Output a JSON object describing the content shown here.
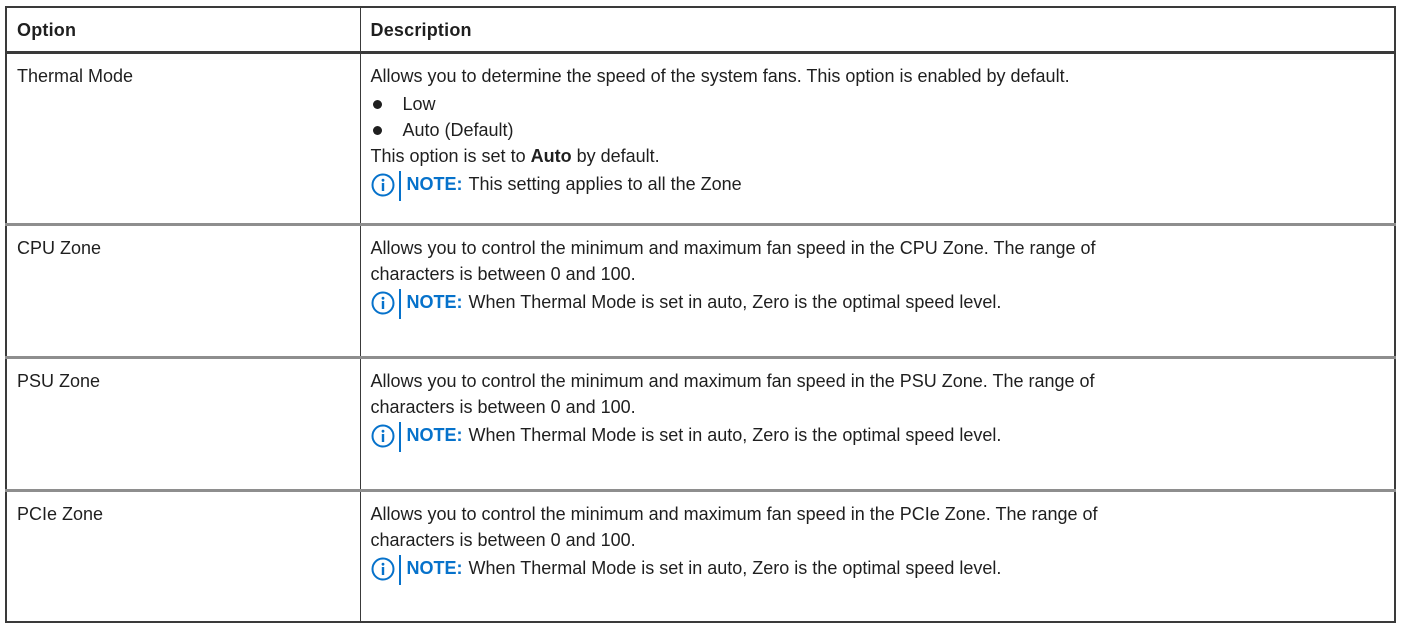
{
  "table": {
    "headers": {
      "option": "Option",
      "description": "Description"
    },
    "rows": [
      {
        "option": "Thermal Mode",
        "description": "Allows you to determine the speed of the system fans. This option is enabled by default.",
        "bullets": [
          "Low",
          "Auto (Default)"
        ],
        "extra_prefix": "This option is set to ",
        "extra_bold": "Auto",
        "extra_suffix": " by default.",
        "note_label": "NOTE:",
        "note_text": "This setting applies to all the Zone"
      },
      {
        "option": "CPU Zone",
        "description_line1": "Allows you to control the minimum and maximum fan speed in the CPU Zone. The range of",
        "description_line2": "characters is between 0 and 100.",
        "note_label": "NOTE:",
        "note_text": "When Thermal Mode is set in auto, Zero is the optimal speed level."
      },
      {
        "option": "PSU Zone",
        "description_line1": "Allows you to control the minimum and maximum fan speed in the PSU Zone. The range of",
        "description_line2": "characters is between 0 and 100.",
        "note_label": "NOTE:",
        "note_text": "When Thermal Mode is set in auto, Zero is the optimal speed level."
      },
      {
        "option": "PCIe Zone",
        "description_line1": "Allows you to control the minimum and maximum fan speed in the PCIe Zone. The range of",
        "description_line2": "characters is between 0 and 100.",
        "note_label": "NOTE:",
        "note_text": "When Thermal Mode is set in auto, Zero is the optimal speed level."
      }
    ]
  },
  "icons": {
    "note": "info-circle-icon"
  },
  "colors": {
    "note_accent": "#0672cb",
    "text": "#1f1f1f",
    "row_divider": "#8e8e8e",
    "border": "#3a3a3a"
  }
}
